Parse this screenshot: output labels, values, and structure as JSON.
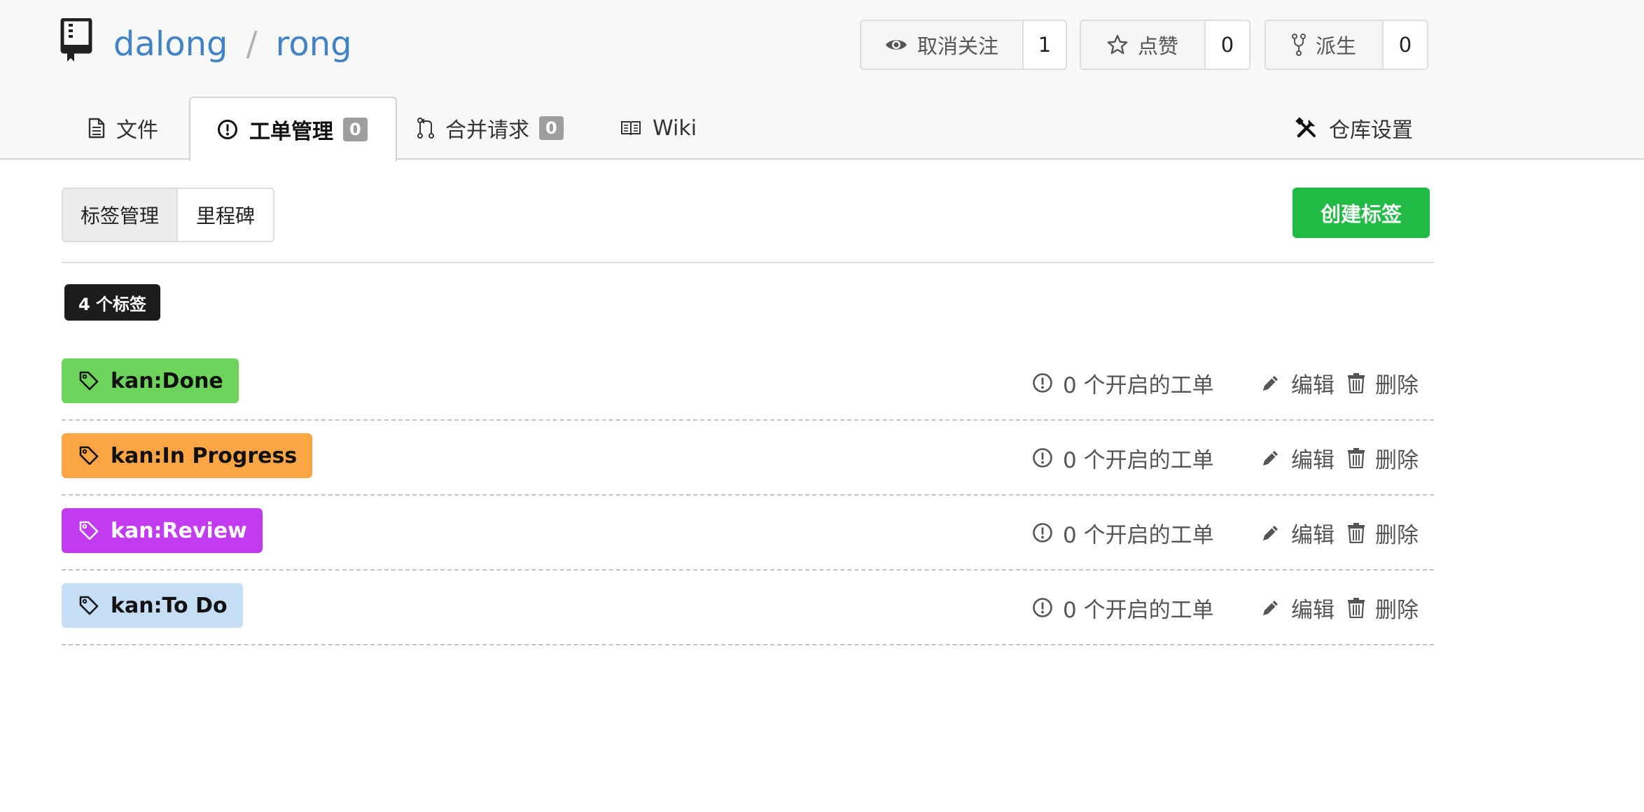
{
  "repo": {
    "owner": "dalong",
    "separator": "/",
    "name": "rong"
  },
  "actions": {
    "watch": {
      "label": "取消关注",
      "count": "1",
      "icon": "eye-icon"
    },
    "star": {
      "label": "点赞",
      "count": "0",
      "icon": "star-icon"
    },
    "fork": {
      "label": "派生",
      "count": "0",
      "icon": "fork-icon"
    }
  },
  "tabs": {
    "files": {
      "label": "文件",
      "icon": "file-icon"
    },
    "issues": {
      "label": "工单管理",
      "badge": "0",
      "icon": "issue-icon"
    },
    "pulls": {
      "label": "合并请求",
      "badge": "0",
      "icon": "pull-request-icon"
    },
    "wiki": {
      "label": "Wiki",
      "icon": "book-icon"
    },
    "settings": {
      "label": "仓库设置",
      "icon": "tools-icon"
    }
  },
  "subnav": {
    "labels": "标签管理",
    "milestones": "里程碑"
  },
  "create_button": "创建标签",
  "label_count": "4 个标签",
  "labels": [
    {
      "name": "kan:Done",
      "color": "#6cd35b",
      "text_color": "#111111",
      "open_issues": "0 个开启的工单",
      "edit": "编辑",
      "delete": "删除"
    },
    {
      "name": "kan:In Progress",
      "color": "#fba544",
      "text_color": "#111111",
      "open_issues": "0 个开启的工单",
      "edit": "编辑",
      "delete": "删除"
    },
    {
      "name": "kan:Review",
      "color": "#c33bf0",
      "text_color": "#ffffff",
      "open_issues": "0 个开启的工单",
      "edit": "编辑",
      "delete": "删除"
    },
    {
      "name": "kan:To Do",
      "color": "#c5ddf5",
      "text_color": "#111111",
      "open_issues": "0 个开启的工单",
      "edit": "编辑",
      "delete": "删除"
    }
  ],
  "colors": {
    "accent_link": "#4183c4",
    "create_green": "#21ba45",
    "badge_grey": "#9e9e9e"
  }
}
